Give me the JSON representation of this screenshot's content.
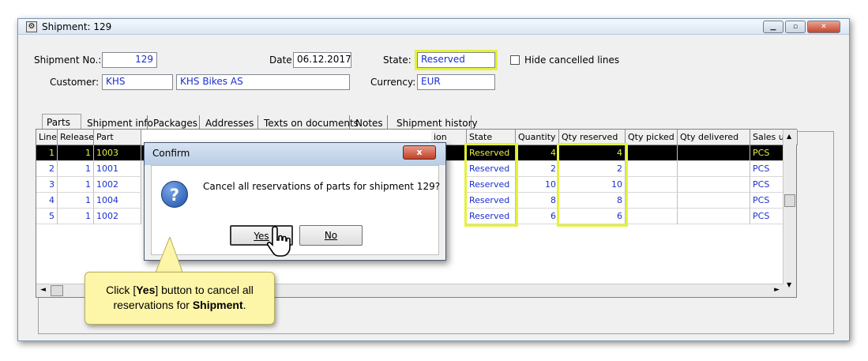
{
  "window": {
    "title": "Shipment: 129",
    "controls": [
      "minimize",
      "maximize",
      "close"
    ]
  },
  "header": {
    "shipment_no_label": "Shipment No.:",
    "shipment_no_value": "129",
    "date_label": "Date:",
    "date_value": "06.12.2017",
    "state_label": "State:",
    "state_value": "Reserved",
    "hide_cancelled_label": "Hide cancelled lines",
    "customer_label": "Customer:",
    "customer_code": "KHS",
    "customer_name": "KHS Bikes AS",
    "currency_label": "Currency:",
    "currency_value": "EUR"
  },
  "tabs": [
    "Parts",
    "Shipment info",
    "Packages",
    "Addresses",
    "Texts on documents",
    "Notes",
    "Shipment history"
  ],
  "grid": {
    "columns": [
      "Line",
      "Release",
      "Part",
      "ion",
      "State",
      "Quantity",
      "Qty reserved",
      "Qty picked",
      "Qty delivered",
      "Sales unit"
    ],
    "rows": [
      {
        "line": "1",
        "release": "1",
        "part": "1003",
        "state": "Reserved",
        "quantity": "4",
        "qty_reserved": "4",
        "sales_unit": "PCS"
      },
      {
        "line": "2",
        "release": "1",
        "part": "1001",
        "state": "Reserved",
        "quantity": "2",
        "qty_reserved": "2",
        "sales_unit": "PCS"
      },
      {
        "line": "3",
        "release": "1",
        "part": "1002",
        "state": "Reserved",
        "quantity": "10",
        "qty_reserved": "10",
        "sales_unit": "PCS"
      },
      {
        "line": "4",
        "release": "1",
        "part": "1004",
        "state": "Reserved",
        "quantity": "8",
        "qty_reserved": "8",
        "sales_unit": "PCS"
      },
      {
        "line": "5",
        "release": "1",
        "part": "1002",
        "state": "Reserved",
        "quantity": "6",
        "qty_reserved": "6",
        "sales_unit": "PCS"
      }
    ]
  },
  "dialog": {
    "title": "Confirm",
    "close_glyph": "x",
    "icon_glyph": "?",
    "message": "Cancel all reservations of parts for shipment 129?",
    "yes_label": "Yes",
    "no_label": "No"
  },
  "callout": {
    "text_pre": "Click [",
    "text_bold1": "Yes",
    "text_mid": "] button to cancel all reservations for ",
    "text_bold2": "Shipment",
    "text_post": "."
  },
  "colors": {
    "highlight": "#e4f23a",
    "value_text": "#1a2fd1",
    "callout_bg": "#fdf6a8"
  }
}
